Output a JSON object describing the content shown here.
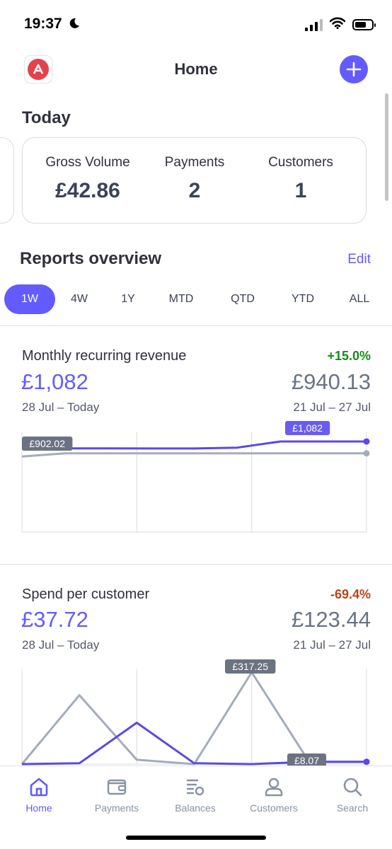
{
  "status_bar": {
    "time": "19:37"
  },
  "header": {
    "title": "Home",
    "add_icon": "plus-icon"
  },
  "today": {
    "title": "Today",
    "stats": [
      {
        "label": "Gross Volume",
        "value": "£42.86"
      },
      {
        "label": "Payments",
        "value": "2"
      },
      {
        "label": "Customers",
        "value": "1"
      }
    ]
  },
  "reports": {
    "title": "Reports overview",
    "edit_label": "Edit",
    "ranges": [
      "1W",
      "4W",
      "1Y",
      "MTD",
      "QTD",
      "YTD",
      "ALL"
    ],
    "active_range": "1W"
  },
  "cards": [
    {
      "title": "Monthly recurring revenue",
      "delta": "+15.0%",
      "delta_color": "#1a8a1a",
      "current_value": "£1,082",
      "current_period": "28 Jul – Today",
      "previous_value": "£940.13",
      "previous_period": "21 Jul – 27 Jul"
    },
    {
      "title": "Spend per customer",
      "delta": "-69.4%",
      "delta_color": "#c0421b",
      "current_value": "£37.72",
      "current_period": "28 Jul – Today",
      "previous_value": "£123.44",
      "previous_period": "21 Jul – 27 Jul"
    }
  ],
  "chart_data": [
    {
      "type": "line",
      "ylim": [
        0,
        1200
      ],
      "series": [
        {
          "values": [
            902.02,
            940.13,
            940.13,
            940.13,
            940.13,
            940.13,
            940.13,
            940.13,
            940.13
          ],
          "color": "#a3acb9"
        },
        {
          "values": [
            1000,
            1000,
            1000,
            998,
            998,
            1008,
            1082,
            1082,
            1082
          ],
          "color": "#5a48e8"
        }
      ],
      "annotations": [
        {
          "text": "£902.02",
          "style": "gray"
        },
        {
          "text": "£1,082",
          "style": "purple"
        }
      ]
    },
    {
      "type": "line",
      "ylim": [
        0,
        330
      ],
      "series": [
        {
          "values": [
            0,
            238,
            15,
            0,
            317.25,
            8.07,
            8.07
          ],
          "color": "#a3acb9"
        },
        {
          "values": [
            0,
            3,
            143,
            3,
            0,
            8,
            8
          ],
          "color": "#5a48e8"
        }
      ],
      "annotations": [
        {
          "text": "£317.25",
          "style": "gray"
        },
        {
          "text": "£8.07",
          "style": "gray"
        }
      ]
    }
  ],
  "tabbar": [
    {
      "label": "Home",
      "icon": "home-icon",
      "active": true
    },
    {
      "label": "Payments",
      "icon": "wallet-icon",
      "active": false
    },
    {
      "label": "Balances",
      "icon": "balances-icon",
      "active": false
    },
    {
      "label": "Customers",
      "icon": "person-icon",
      "active": false
    },
    {
      "label": "Search",
      "icon": "search-icon",
      "active": false
    }
  ]
}
